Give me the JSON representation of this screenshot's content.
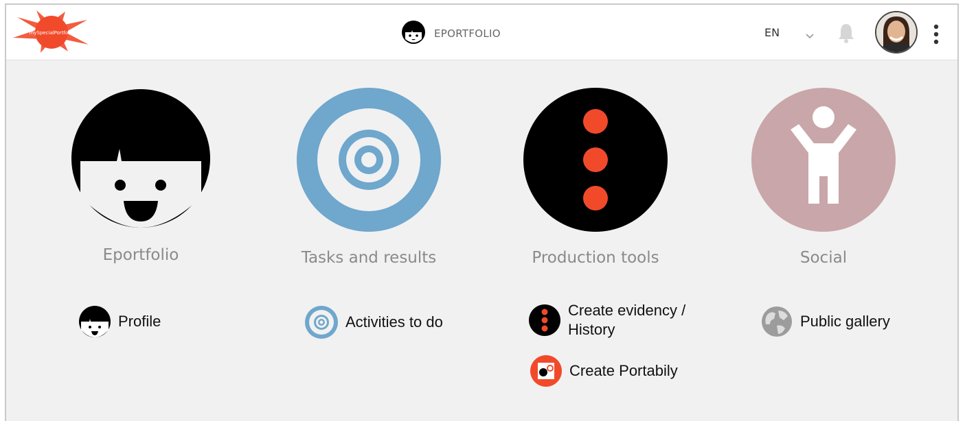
{
  "header": {
    "logo_text": "mySpecialPortfolio",
    "title": "EPORTFOLIO",
    "language": "EN",
    "icons": {
      "logo": "splat-logo",
      "title": "face-icon",
      "chevron": "chevron-down-icon",
      "bell": "bell-icon",
      "avatar": "user-avatar",
      "menu": "kebab-menu-icon"
    }
  },
  "modules": [
    {
      "title": "Eportfolio",
      "icon": "face-icon",
      "color": "#000000",
      "links": [
        {
          "label": "Profile",
          "icon": "face-icon"
        }
      ]
    },
    {
      "title": "Tasks and results",
      "icon": "target-icon",
      "color": "#6fa7cd",
      "links": [
        {
          "label": "Activities to do",
          "icon": "target-icon"
        }
      ]
    },
    {
      "title": "Production tools",
      "icon": "dots-icon",
      "color": "#000000",
      "accent": "#f14a2b",
      "links": [
        {
          "label_line1": "Create evidency /",
          "label_line2": "History",
          "icon": "dots-icon"
        },
        {
          "label": "Create Portabily",
          "icon": "portabily-icon"
        }
      ]
    },
    {
      "title": "Social",
      "icon": "person-arms-up-icon",
      "color": "#c9a6a9",
      "links": [
        {
          "label": "Public gallery",
          "icon": "globe-icon"
        }
      ]
    }
  ]
}
